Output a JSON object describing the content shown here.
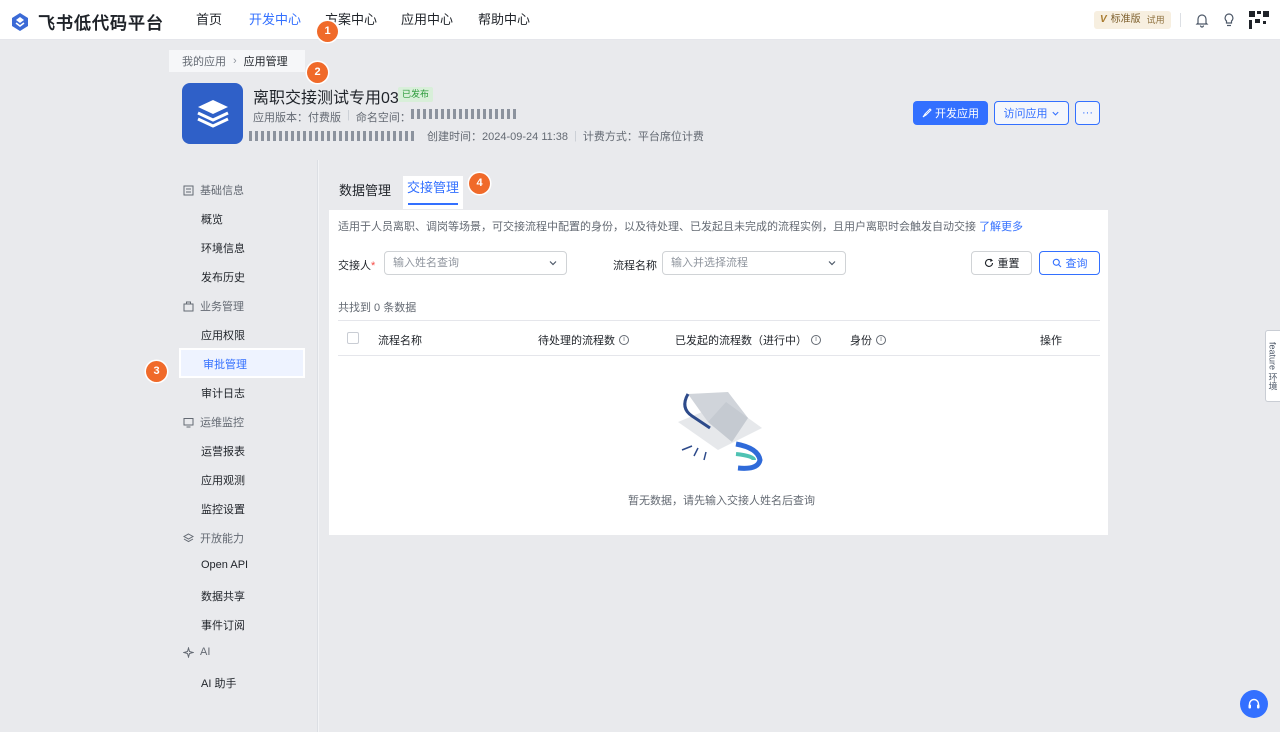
{
  "brand": {
    "name": "飞书低代码平台"
  },
  "nav": {
    "items": [
      "首页",
      "开发中心",
      "方案中心",
      "应用中心",
      "帮助中心"
    ],
    "active_index": 1
  },
  "plan": {
    "label": "标准版",
    "trial": "试用"
  },
  "breadcrumb": {
    "parent": "我的应用",
    "current": "应用管理"
  },
  "app": {
    "name": "离职交接测试专用03",
    "status": "已发布",
    "version_label": "应用版本：付费版",
    "namespace_label": "命名空间：",
    "created_label": "创建时间：2024-09-24 11:38",
    "billing_label": "计费方式：平台席位计费"
  },
  "actions": {
    "develop": "开发应用",
    "visit": "访问应用",
    "more": "···"
  },
  "sidebar": {
    "groups": [
      {
        "label": "基础信息",
        "items": [
          "概览",
          "环境信息",
          "发布历史"
        ]
      },
      {
        "label": "业务管理",
        "items": [
          "应用权限",
          "审批管理",
          "审计日志"
        ]
      },
      {
        "label": "运维监控",
        "items": [
          "运营报表",
          "应用观测",
          "监控设置"
        ]
      },
      {
        "label": "开放能力",
        "items": [
          "Open API",
          "数据共享",
          "事件订阅"
        ]
      },
      {
        "label": "AI",
        "items": [
          "AI 助手"
        ]
      }
    ],
    "active": "审批管理"
  },
  "tabs": {
    "data": "数据管理",
    "handover": "交接管理"
  },
  "handover": {
    "description": "适用于人员离职、调岗等场景，可交接流程中配置的身份，以及待处理、已发起且未完成的流程实例，且用户离职时会触发自动交接",
    "learn_more": "了解更多",
    "receiver_label": "交接人",
    "receiver_required": "*",
    "receiver_placeholder": "输入姓名查询",
    "flow_label": "流程名称",
    "flow_placeholder": "输入并选择流程",
    "reset": "重置",
    "query": "查询",
    "count": "共找到 0 条数据",
    "columns": [
      "流程名称",
      "待处理的流程数",
      "已发起的流程数（进行中）",
      "身份",
      "操作"
    ],
    "empty": "暂无数据，请先输入交接人姓名后查询"
  },
  "steps": [
    "1",
    "2",
    "3",
    "4"
  ],
  "feature_tab": "feature 环境",
  "colors": {
    "accent": "#3370ff",
    "step": "#f06a2a",
    "app_icon": "#2f60c8"
  }
}
